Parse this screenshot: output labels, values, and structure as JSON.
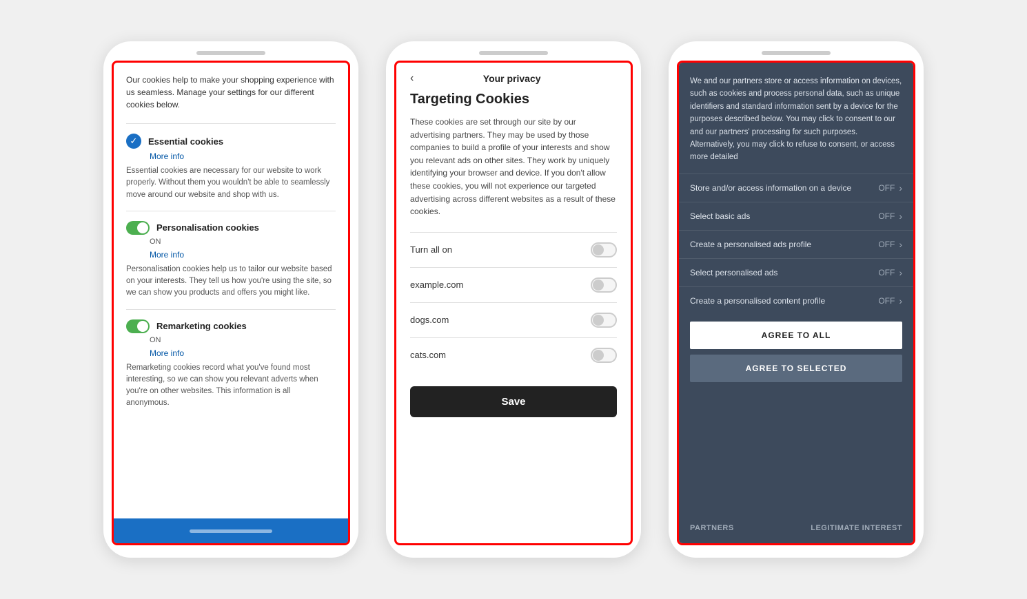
{
  "phone1": {
    "intro": "Our cookies help to make your shopping experience with us seamless. Manage your settings for our different cookies below.",
    "sections": [
      {
        "id": "essential",
        "title": "Essential cookies",
        "more_info": "More info",
        "toggle_type": "check",
        "description": "Essential cookies are necessary for our website to work properly. Without them you wouldn't be able to seamlessly move around our website and shop with us."
      },
      {
        "id": "personalisation",
        "title": "Personalisation cookies",
        "more_info": "More info",
        "toggle_type": "switch",
        "on_label": "ON",
        "description": "Personalisation cookies help us to tailor our website based on your interests. They tell us how you're using the site, so we can show you products and offers you might like."
      },
      {
        "id": "remarketing",
        "title": "Remarketing cookies",
        "more_info": "More info",
        "toggle_type": "switch",
        "on_label": "ON",
        "description": "Remarketing cookies record what you've found most interesting, so we can show you relevant adverts when you're on other websites. This information is all anonymous."
      }
    ]
  },
  "phone2": {
    "back_arrow": "‹",
    "title": "Your privacy",
    "section_title": "Targeting Cookies",
    "description": "These cookies are set through our site by our advertising partners. They may be used by those companies to build a profile of your interests and show you relevant ads on other sites. They work by uniquely identifying your browser and device. If you don't allow these cookies, you will not experience our targeted advertising across different websites as a result of these cookies.",
    "rows": [
      {
        "label": "Turn all on"
      },
      {
        "label": "example.com"
      },
      {
        "label": "dogs.com"
      },
      {
        "label": "cats.com"
      }
    ],
    "save_label": "Save"
  },
  "phone3": {
    "description": "We and our partners store or access information on devices, such as cookies and process personal data, such as unique identifiers and standard information sent by a device for the purposes described below. You may click to consent to our and our partners' processing for such purposes. Alternatively, you may click to refuse to consent, or access more detailed",
    "rows": [
      {
        "label": "Store and/or access information on a device",
        "value": "OFF"
      },
      {
        "label": "Select basic ads",
        "value": "OFF"
      },
      {
        "label": "Create a personalised ads profile",
        "value": "OFF"
      },
      {
        "label": "Select personalised ads",
        "value": "OFF"
      },
      {
        "label": "Create a personalised content profile",
        "value": "OFF"
      }
    ],
    "agree_all": "AGREE TO ALL",
    "agree_selected": "AGREE TO SELECTED",
    "partners": "PARTNERS",
    "legitimate_interest": "LEGITIMATE INTEREST"
  }
}
